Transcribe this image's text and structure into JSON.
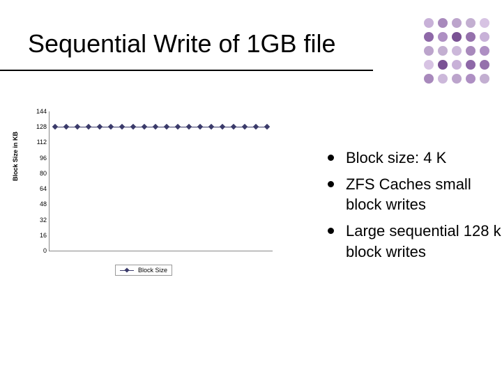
{
  "title": "Sequential Write of 1GB file",
  "bullets": [
    "Block size: 4 K",
    "ZFS Caches small block writes",
    "Large sequential 128 k block writes"
  ],
  "chart_data": {
    "type": "line",
    "title": "",
    "xlabel": "",
    "ylabel": "Block Size in KB",
    "ylim": [
      0,
      144
    ],
    "yticks": [
      0,
      16,
      32,
      48,
      64,
      80,
      96,
      112,
      128,
      144
    ],
    "series": [
      {
        "name": "Block Size",
        "values": [
          128,
          128,
          128,
          128,
          128,
          128,
          128,
          128,
          128,
          128,
          128,
          128,
          128,
          128,
          128,
          128,
          128,
          128,
          128,
          128
        ]
      }
    ]
  }
}
